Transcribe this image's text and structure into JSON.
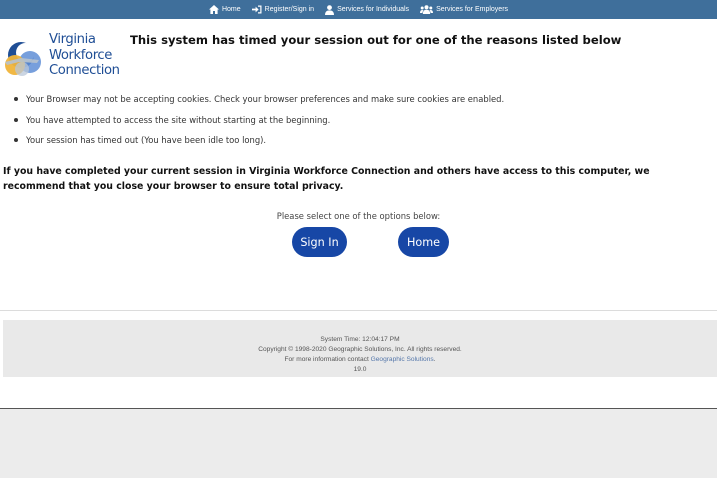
{
  "nav": {
    "items": [
      {
        "label": "Home",
        "icon": "home-icon"
      },
      {
        "label": "Register/Sign in",
        "icon": "sign-in-icon"
      },
      {
        "label": "Services for Individuals",
        "icon": "user-icon"
      },
      {
        "label": "Services for Employers",
        "icon": "users-icon"
      }
    ]
  },
  "logo": {
    "line1": "Virginia",
    "line2": "Workforce",
    "line3": "Connection"
  },
  "page": {
    "title": "This system has timed your session out for one of the reasons listed below",
    "reasons": [
      "Your Browser may not be accepting cookies. Check your browser preferences and make sure cookies are enabled.",
      "You have attempted to access the site without starting at the beginning.",
      "Your session has timed out (You have been idle too long)."
    ],
    "notice": "If you have completed your current session in Virginia Workforce Connection and others have access to this computer, we recommend that you close your browser to ensure total privacy.",
    "prompt": "Please select one of the options below:",
    "signin_label": "Sign In",
    "home_label": "Home"
  },
  "footer": {
    "system_time": "System Time: 12:04:17 PM",
    "copyright": "Copyright © 1998-2020 Geographic Solutions, Inc. All rights reserved.",
    "contact_prefix": "For more information contact ",
    "contact_link": "Geographic Solutions",
    "contact_suffix": ".",
    "version": "19.0"
  },
  "colors": {
    "nav_bar": "#3f6f9b",
    "button": "#1747a6",
    "logo_text": "#1f4e95",
    "footer_bg": "#e9e9e9"
  }
}
